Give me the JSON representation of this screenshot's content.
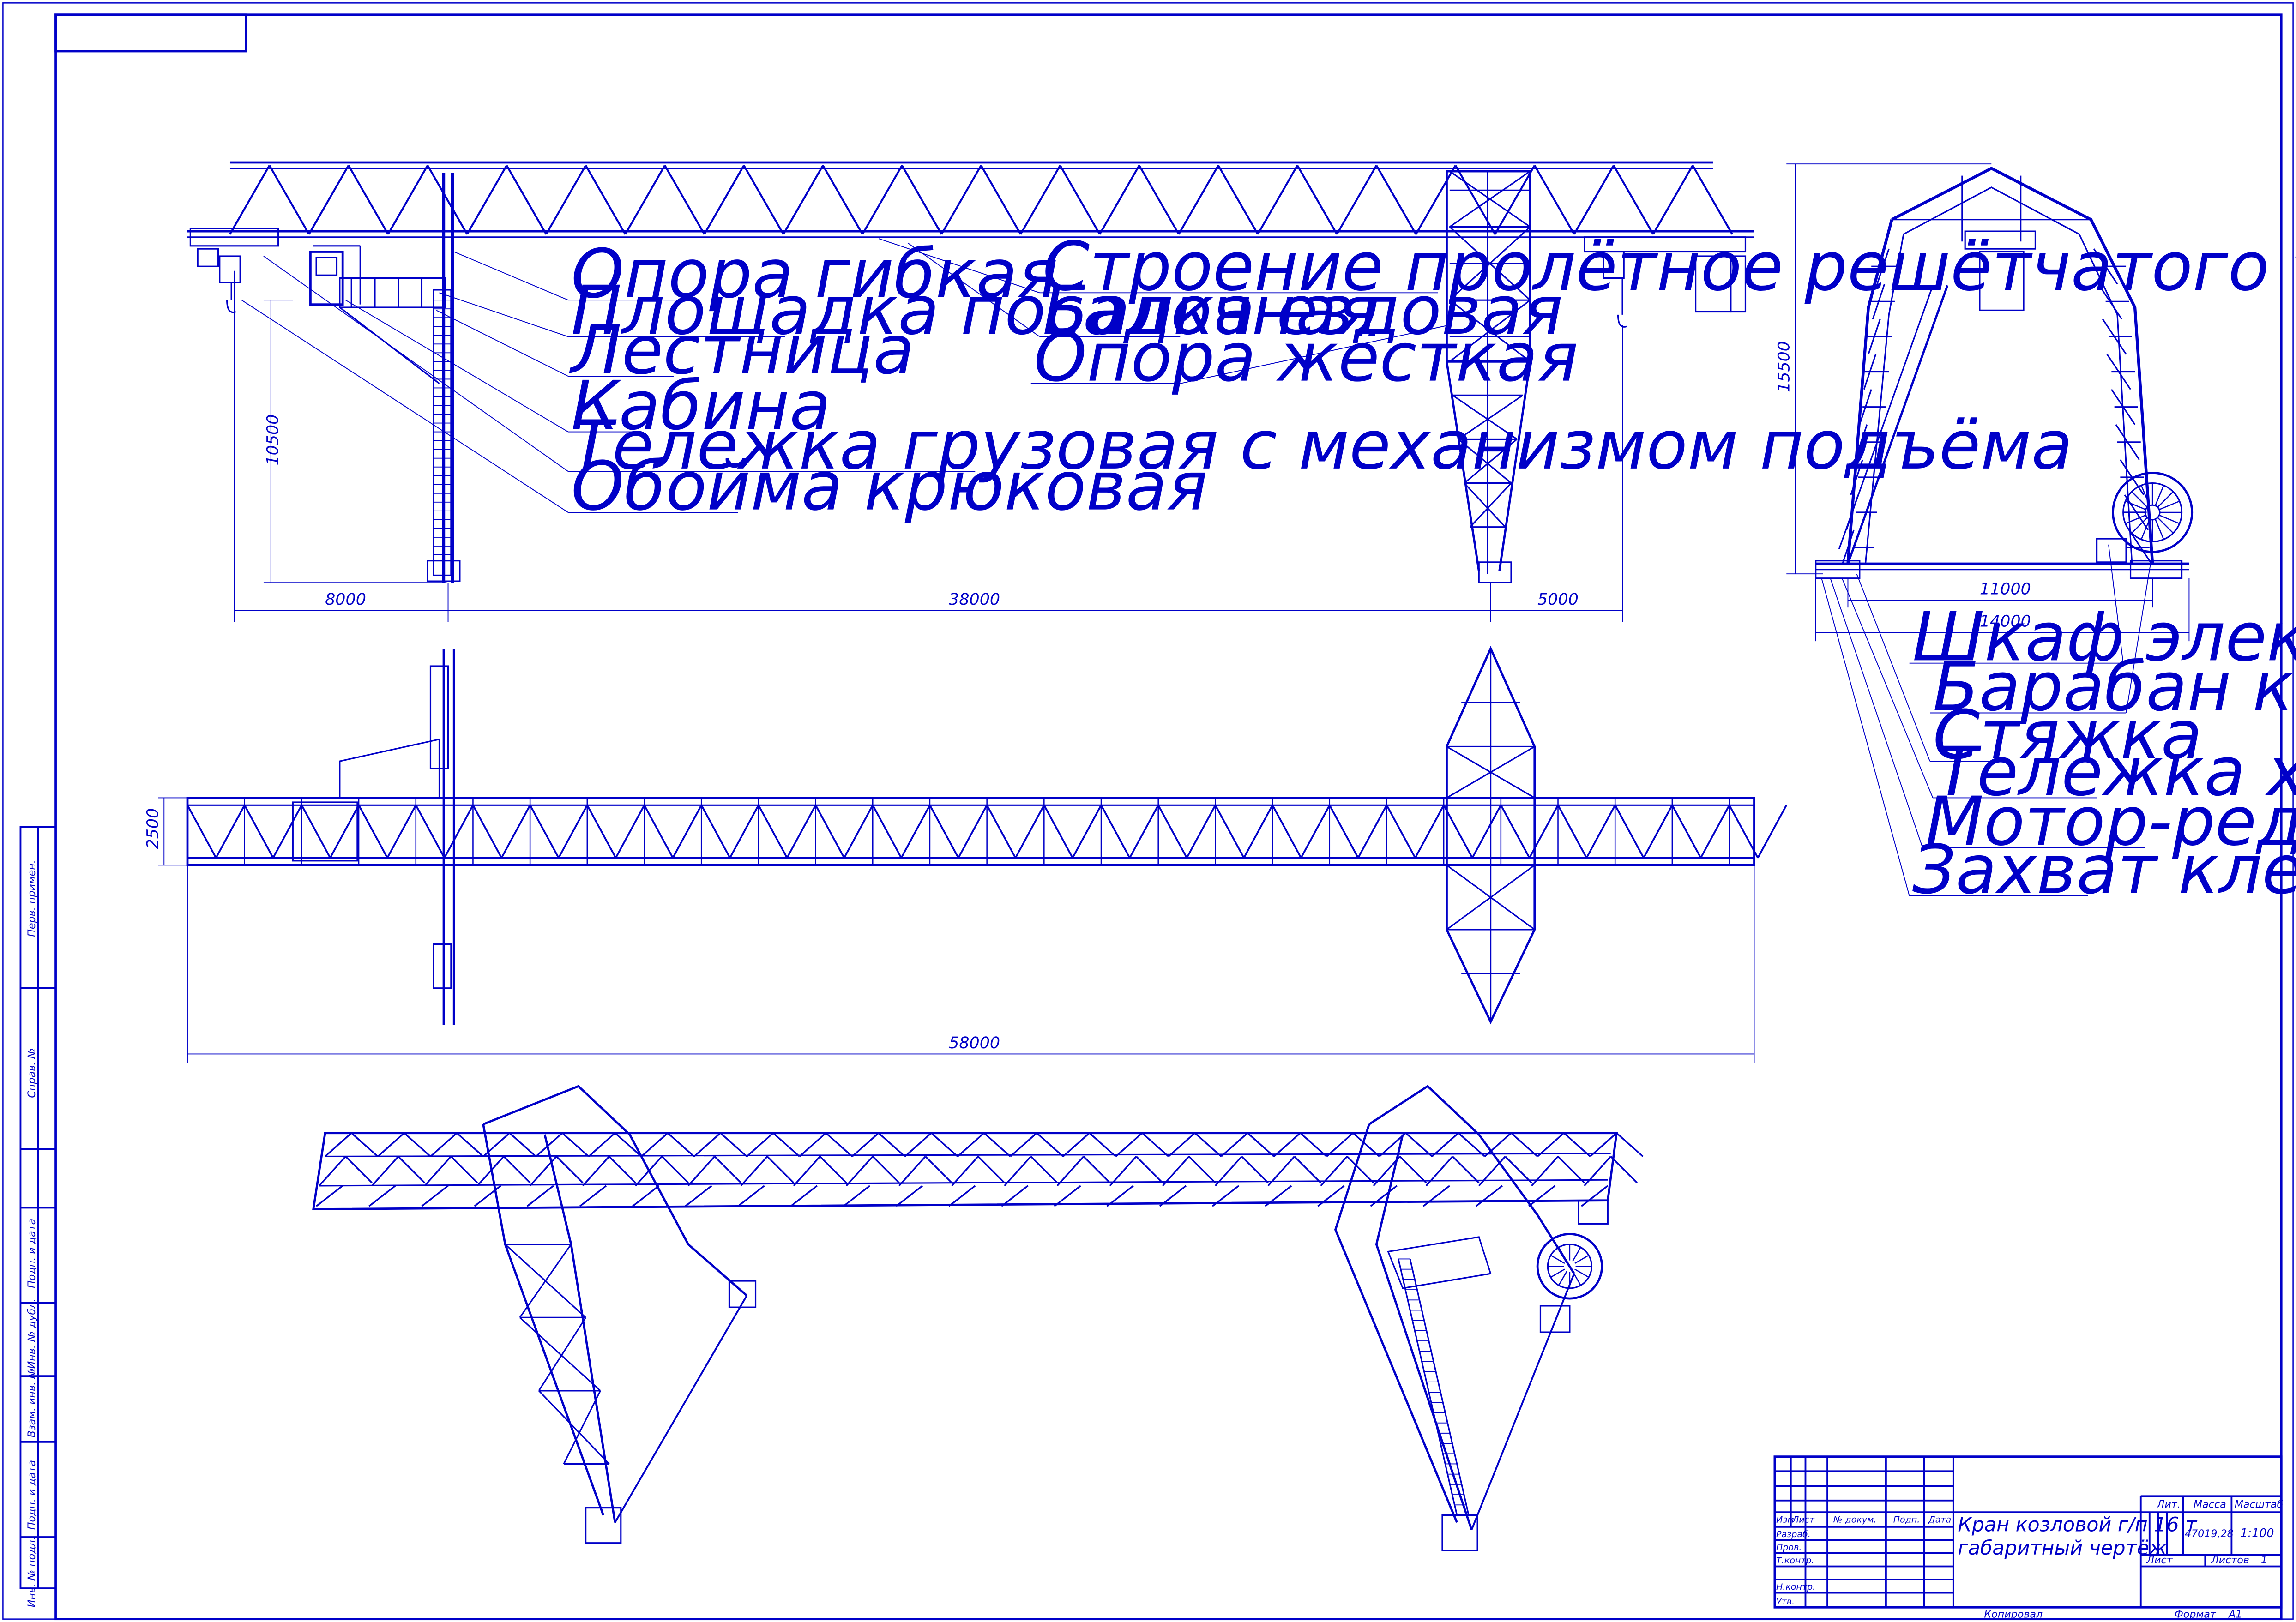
{
  "drawing": {
    "line_color": "#0000c8",
    "background": "#ffffff"
  },
  "labels": {
    "opora_gibkaya": "Опора гибкая",
    "ploshchadka": "Площадка посадочная",
    "lestnitsa": "Лестница",
    "kabina": "Кабина",
    "telezhka_gruzovaya": "Тележка грузовая с механизмом подъёма",
    "oboima": "Обойма крюковая",
    "stroenie": "Строение пролётное решётчатого типа",
    "balka": "Балка ездовая",
    "opora_zhestkaya": "Опора жёсткая",
    "shkaf": "Шкаф электрический",
    "baraban": "Барабан кабельный",
    "styazhka": "Стяжка",
    "telezhka_hodovaya": "Тележка ходовая",
    "motor_reduktor": "Мотор-редуктор хода",
    "zahvat": "Захват клещевой"
  },
  "dimensions": {
    "d8000": "8000",
    "d38000": "38000",
    "d5000": "5000",
    "d10500": "10500",
    "d2500": "2500",
    "d58000": "58000",
    "d15500": "15500",
    "d11000": "11000",
    "d14000": "14000"
  },
  "side_stamp": {
    "perv_primen": "Перв. примен.",
    "sprav_no": "Справ. №",
    "podp_i_data_1": "Подп. и дата",
    "inv_no_dubl": "Инв. № дубл.",
    "vzam_inv_no": "Взам. инв. №",
    "podp_i_data_2": "Подп. и дата",
    "inv_no_podl": "Инв. № подл."
  },
  "title_block": {
    "izm": "Изм",
    "list": "Лист",
    "no_dokum": "№ докум.",
    "podp": "Подп.",
    "data": "Дата",
    "razrab": "Разраб.",
    "prov": "Пров.",
    "t_kontr": "Т.контр.",
    "n_kontr": "Н.контр.",
    "utv": "Утв.",
    "title_line1": "Кран козловой г/п 16 т",
    "title_line2": "габаритный чертёж",
    "lit": "Лит.",
    "massa": "Масса",
    "masshtab": "Масштаб",
    "massa_value": "47019,28",
    "scale_value": "1:100",
    "list_label": "Лист",
    "listov_label": "Листов",
    "listov_value": "1",
    "kopiroval": "Копировал",
    "format_label": "Формат",
    "format_value": "А1"
  }
}
